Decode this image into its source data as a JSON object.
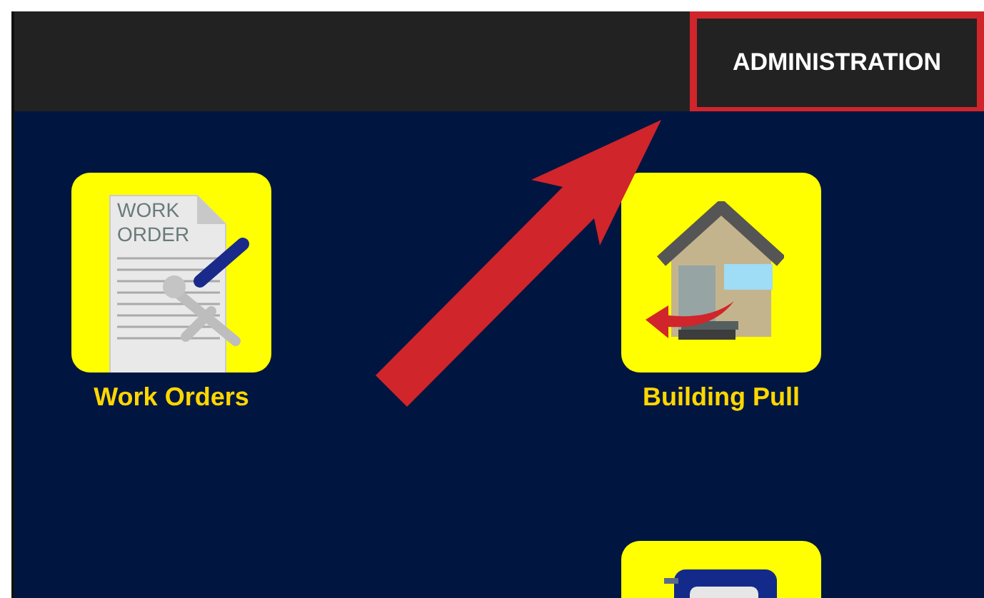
{
  "top_bar": {
    "admin_button": {
      "label": "ADMINISTRATION",
      "highlighted": true
    }
  },
  "tiles": [
    {
      "kind": "work-orders",
      "label": "Work Orders",
      "icon_text": [
        "WORK",
        "ORDER"
      ]
    },
    {
      "kind": "building-pull",
      "label": "Building Pull"
    },
    {
      "kind": "partial"
    }
  ]
}
